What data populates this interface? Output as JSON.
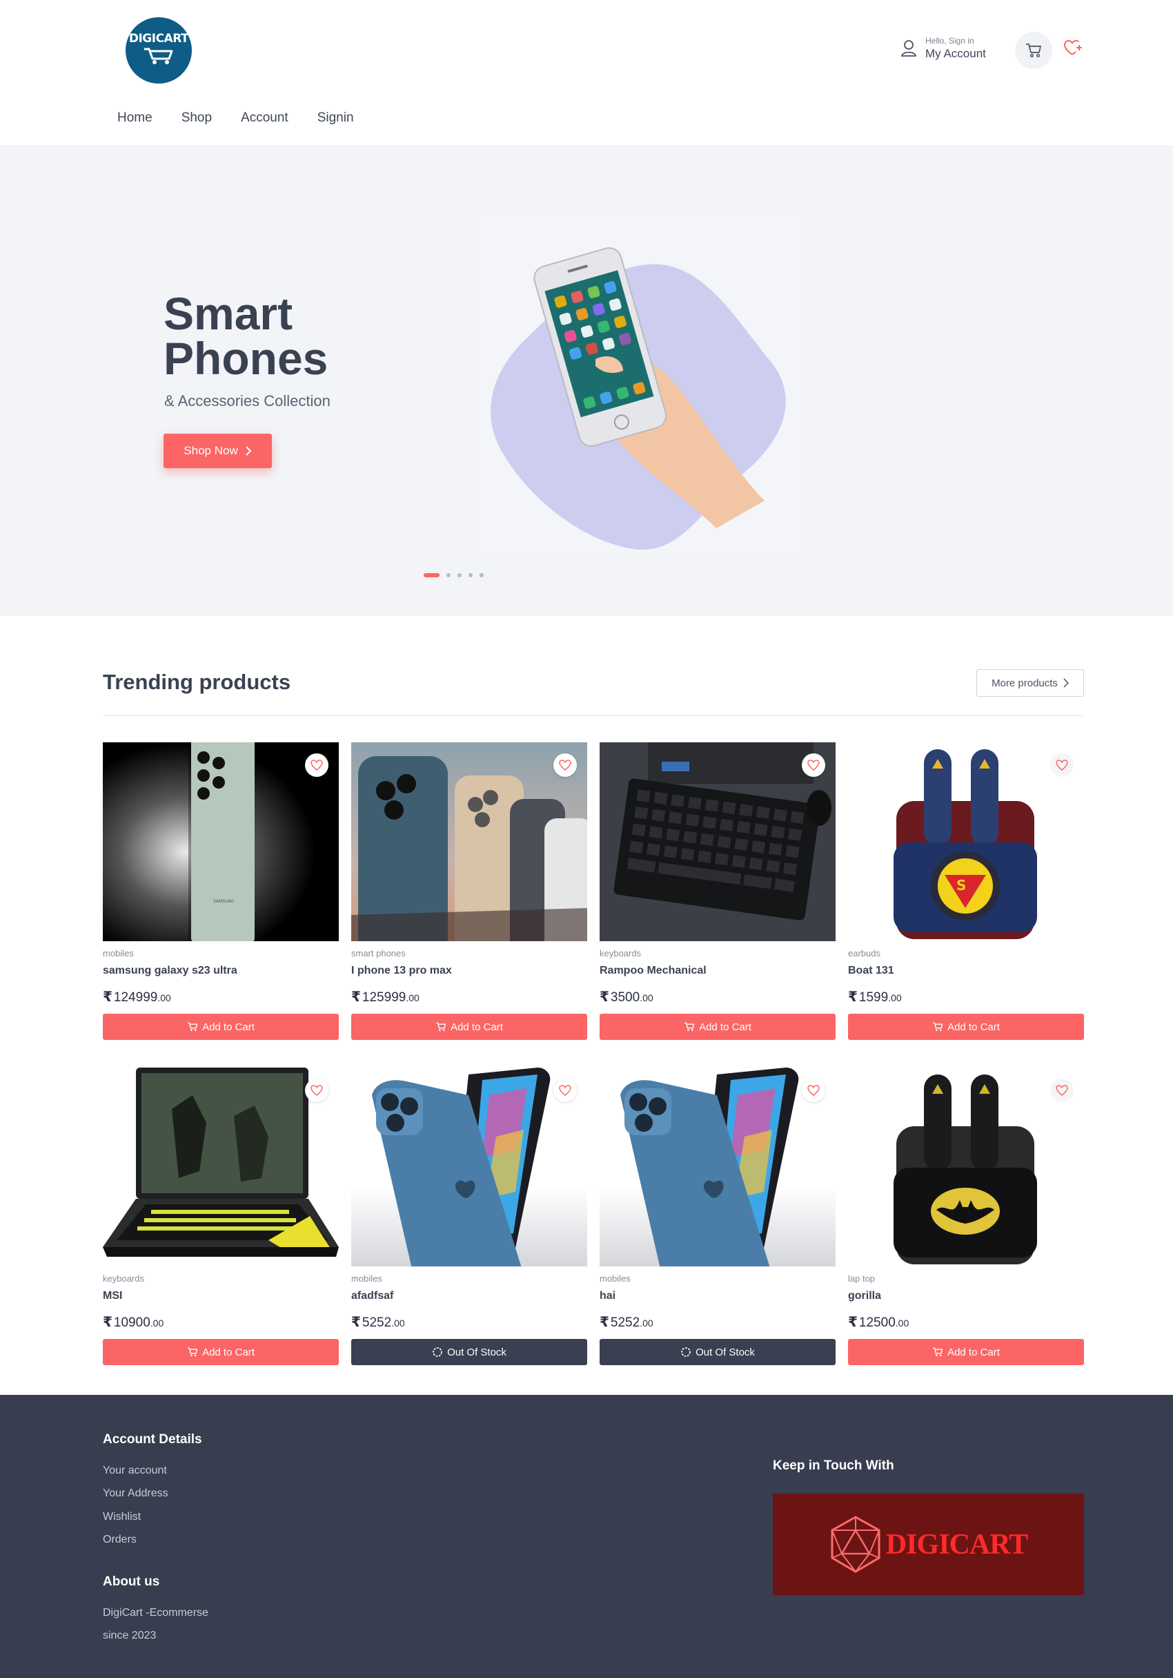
{
  "header": {
    "logo_text": "DIGICART",
    "account_hello": "Hello, Sign in",
    "account_label": "My Account",
    "icons": [
      "user-icon",
      "cart-icon",
      "heart-plus-icon"
    ]
  },
  "nav": {
    "items": [
      "Home",
      "Shop",
      "Account",
      "Signin"
    ]
  },
  "hero": {
    "title_line1": "Smart",
    "title_line2": "Phones",
    "subtitle": "& Accessories Collection",
    "cta": "Shop Now",
    "slides": 5,
    "active_slide": 1
  },
  "trending": {
    "title": "Trending products",
    "more_label": "More products",
    "products": [
      {
        "category": "mobiles",
        "name": "samsung galaxy s23 ultra",
        "price": "124999",
        "decimals": ".00",
        "button": "Add to Cart",
        "in_stock": true
      },
      {
        "category": "smart phones",
        "name": "I phone 13 pro max",
        "price": "125999",
        "decimals": ".00",
        "button": "Add to Cart",
        "in_stock": true
      },
      {
        "category": "keyboards",
        "name": "Rampoo Mechanical",
        "price": "3500",
        "decimals": ".00",
        "button": "Add to Cart",
        "in_stock": true
      },
      {
        "category": "earbuds",
        "name": "Boat 131",
        "price": "1599",
        "decimals": ".00",
        "button": "Add to Cart",
        "in_stock": true
      },
      {
        "category": "keyboards",
        "name": "MSI",
        "price": "10900",
        "decimals": ".00",
        "button": "Add to Cart",
        "in_stock": true
      },
      {
        "category": "mobiles",
        "name": "afadfsaf",
        "price": "5252",
        "decimals": ".00",
        "button": "Out Of Stock",
        "in_stock": false
      },
      {
        "category": "mobiles",
        "name": "hai",
        "price": "5252",
        "decimals": ".00",
        "button": "Out Of Stock",
        "in_stock": false
      },
      {
        "category": "lap top",
        "name": "gorilla",
        "price": "12500",
        "decimals": ".00",
        "button": "Add to Cart",
        "in_stock": true
      }
    ]
  },
  "footer": {
    "account_heading": "Account Details",
    "account_links": [
      "Your account",
      "Your Address",
      "Wishlist",
      "Orders"
    ],
    "about_heading": "About us",
    "about_lines": [
      "DigiCart -Ecommerse",
      "since 2023"
    ],
    "keep_heading": "Keep in Touch With",
    "banner_text": "DIGICART"
  },
  "colors": {
    "accent": "#fb6565",
    "dark": "#383d4f",
    "hero_bg": "#f2f4f8",
    "logo": "#0f5d86",
    "blob": "#cdcdf0"
  }
}
